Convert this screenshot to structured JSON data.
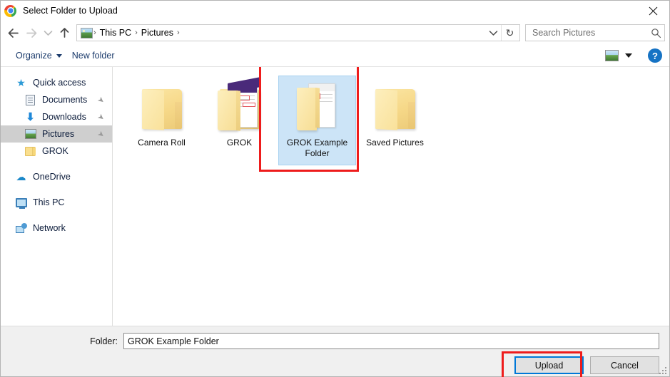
{
  "window": {
    "title": "Select Folder to Upload",
    "app_icon": "chrome-icon",
    "close_label": "✕"
  },
  "nav": {
    "back_icon": "back-arrow-icon",
    "forward_icon": "forward-arrow-icon",
    "recent_icon": "chevron-down-icon",
    "up_icon": "up-arrow-icon",
    "address_icon": "pictures-folder-icon",
    "breadcrumbs": [
      "This PC",
      "Pictures"
    ],
    "separator": "›",
    "dropdown_icon": "chevron-down-icon",
    "refresh_icon": "refresh-icon",
    "refresh_glyph": "↻"
  },
  "search": {
    "placeholder": "Search Pictures",
    "value": "",
    "icon": "search-icon"
  },
  "toolbar": {
    "organize_label": "Organize",
    "new_folder_label": "New folder",
    "view_icon": "view-mode-icon",
    "view_caret_icon": "chevron-down-icon",
    "help_label": "?",
    "help_icon": "help-icon"
  },
  "sidebar": {
    "items": [
      {
        "label": "Quick access",
        "icon": "star-icon",
        "indent": false,
        "pinned": false,
        "selected": false
      },
      {
        "label": "Documents",
        "icon": "document-icon",
        "indent": true,
        "pinned": true,
        "selected": false
      },
      {
        "label": "Downloads",
        "icon": "download-icon",
        "indent": true,
        "pinned": true,
        "selected": false
      },
      {
        "label": "Pictures",
        "icon": "pictures-icon",
        "indent": true,
        "pinned": true,
        "selected": true
      },
      {
        "label": "GROK",
        "icon": "folder-icon",
        "indent": true,
        "pinned": false,
        "selected": false
      },
      {
        "label": "OneDrive",
        "icon": "cloud-icon",
        "indent": false,
        "pinned": false,
        "selected": false
      },
      {
        "label": "This PC",
        "icon": "computer-icon",
        "indent": false,
        "pinned": false,
        "selected": false
      },
      {
        "label": "Network",
        "icon": "network-icon",
        "indent": false,
        "pinned": false,
        "selected": false
      }
    ],
    "pin_glyph": "📌"
  },
  "files": {
    "items": [
      {
        "name": "Camera Roll",
        "icon": "folder-icon",
        "selected": false
      },
      {
        "name": "GROK",
        "icon": "folder-with-preview-icon",
        "selected": false
      },
      {
        "name": "GROK Example Folder",
        "icon": "open-folder-icon",
        "selected": true
      },
      {
        "name": "Saved Pictures",
        "icon": "folder-icon",
        "selected": false
      }
    ]
  },
  "footer": {
    "folder_label": "Folder:",
    "folder_value": "GROK Example Folder",
    "upload_label": "Upload",
    "cancel_label": "Cancel"
  },
  "annotations": {
    "color": "#ee1c1c",
    "selected_folder_highlight": true,
    "upload_button_highlight": true
  },
  "colors": {
    "accent": "#0078d7",
    "selection": "#cce4f7",
    "sidebar_selection": "#cfcfcf",
    "annotation": "#ee1c1c",
    "folder": "#f6d888"
  }
}
